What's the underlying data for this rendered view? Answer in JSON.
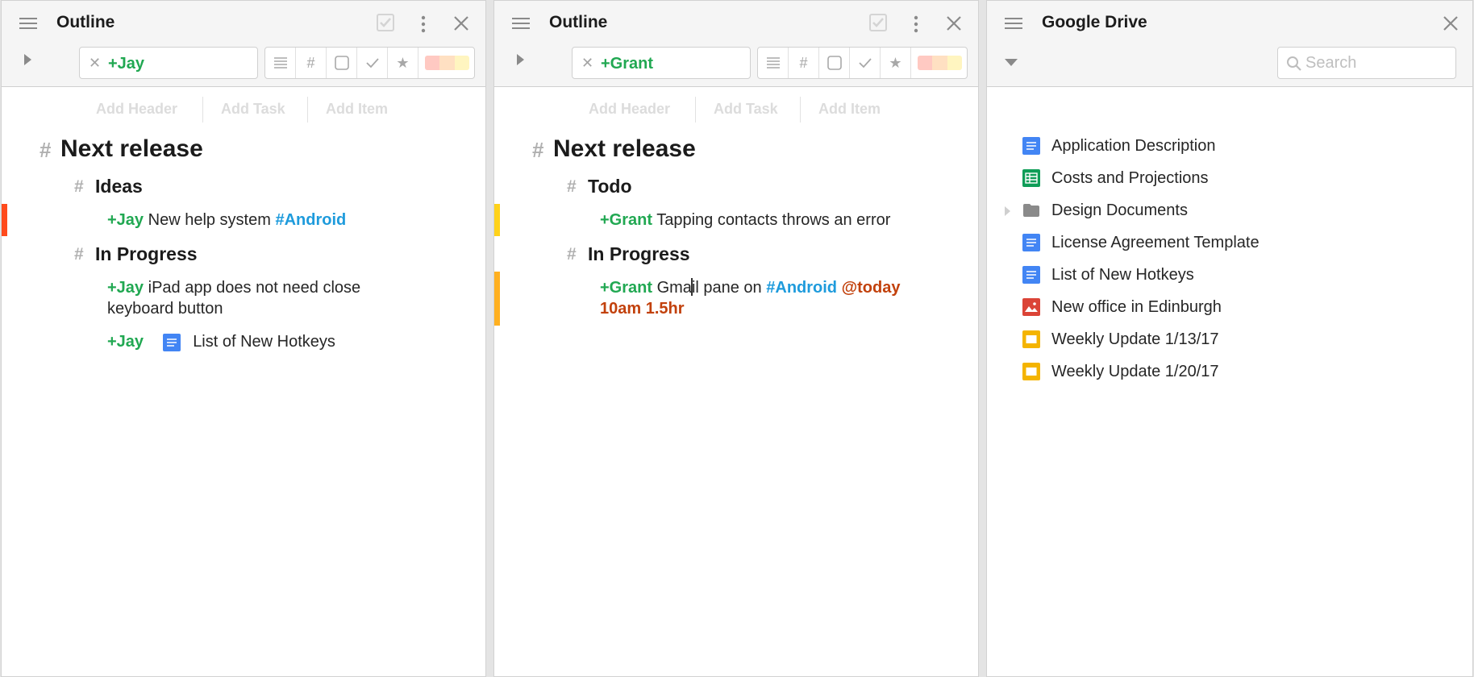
{
  "colors": {
    "person": "#21a852",
    "tag": "#1e9bdc",
    "date": "#c2410c",
    "bar_red": "#ff4a1c",
    "bar_yellow": "#ffd21a",
    "bar_orange": "#ffb020"
  },
  "toolbar_icons": [
    "list-icon",
    "hash-icon",
    "square-icon",
    "check-icon",
    "star-icon",
    "color-swatches"
  ],
  "swatch_colors": [
    "#ffc9c2",
    "#ffe0c2",
    "#fff5c0"
  ],
  "add_row": {
    "header": "Add Header",
    "task": "Add Task",
    "item": "Add Item"
  },
  "outline1": {
    "title": "Outline",
    "filter": "+Jay",
    "heading": "Next release",
    "section_a": "Ideas",
    "section_b": "In Progress",
    "item1": {
      "person": "+Jay",
      "text": "New help system",
      "tag": "#Android"
    },
    "item2": {
      "person": "+Jay",
      "text": "iPad app does not need close keyboard button"
    },
    "item3": {
      "person": "+Jay",
      "doc": "List of New Hotkeys"
    }
  },
  "outline2": {
    "title": "Outline",
    "filter": "+Grant",
    "heading": "Next release",
    "section_a": "Todo",
    "section_b": "In Progress",
    "item1": {
      "person": "+Grant",
      "text": "Tapping contacts throws an error"
    },
    "item2": {
      "person": "+Grant",
      "text_a": "Gma",
      "text_b": "il pane on",
      "tag": "#Android",
      "date_a": "@today",
      "date_b": "10am 1.5hr"
    }
  },
  "drive": {
    "title": "Google Drive",
    "search_placeholder": "Search",
    "files": [
      {
        "name": "Application Description",
        "icon": "doc-icon"
      },
      {
        "name": "Costs and Projections",
        "icon": "sheet-icon"
      },
      {
        "name": "Design Documents",
        "icon": "folder-icon"
      },
      {
        "name": "License Agreement Template",
        "icon": "doc-icon"
      },
      {
        "name": "List of New Hotkeys",
        "icon": "doc-icon"
      },
      {
        "name": "New office in Edinburgh",
        "icon": "image-icon"
      },
      {
        "name": "Weekly Update 1/13/17",
        "icon": "slides-icon"
      },
      {
        "name": "Weekly Update 1/20/17",
        "icon": "slides-icon"
      }
    ]
  }
}
